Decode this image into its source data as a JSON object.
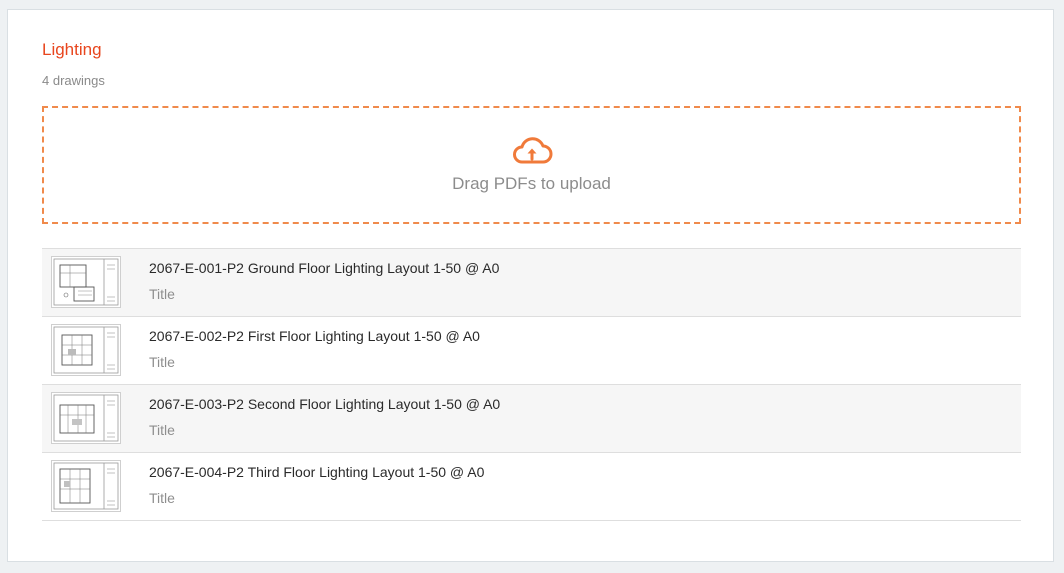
{
  "section": {
    "title": "Lighting",
    "count_label": "4 drawings"
  },
  "upload": {
    "icon": "cloud-upload-icon",
    "label": "Drag PDFs to upload"
  },
  "colors": {
    "accent": "#e8461e",
    "dropzone_border": "#f08a4b"
  },
  "drawings": [
    {
      "name": "2067-E-001-P2 Ground Floor Lighting Layout 1-50 @ A0",
      "meta": "Title"
    },
    {
      "name": "2067-E-002-P2 First Floor Lighting Layout 1-50 @ A0",
      "meta": "Title"
    },
    {
      "name": "2067-E-003-P2 Second Floor Lighting Layout 1-50 @ A0",
      "meta": "Title"
    },
    {
      "name": "2067-E-004-P2 Third Floor Lighting Layout 1-50 @ A0",
      "meta": "Title"
    }
  ]
}
